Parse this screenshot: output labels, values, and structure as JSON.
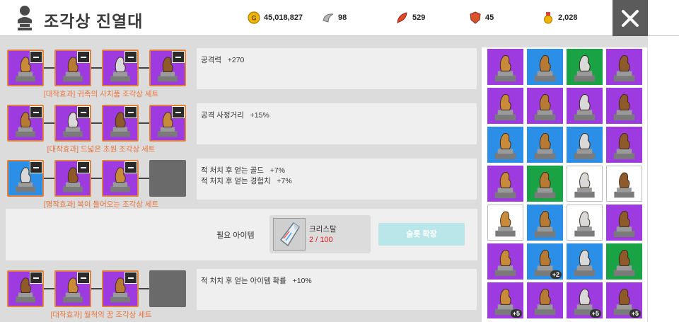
{
  "header": {
    "title": "조각상 진열대",
    "resources": [
      {
        "name": "gold",
        "icon": "gold-coin-icon",
        "value": "45,018,827"
      },
      {
        "name": "horn",
        "icon": "silver-horn-icon",
        "value": "98"
      },
      {
        "name": "feather",
        "icon": "red-feather-icon",
        "value": "529"
      },
      {
        "name": "shield",
        "icon": "shield-badge-icon",
        "value": "45"
      },
      {
        "name": "medal",
        "icon": "medal-icon",
        "value": "2,028"
      }
    ]
  },
  "sets": [
    {
      "name": "[대작효과] 귀족의 사치품 조각상 세트",
      "effects": [
        "공격력   +270"
      ],
      "slots": [
        "purple",
        "purple",
        "purple",
        "purple"
      ]
    },
    {
      "name": "[대작효과] 드넓은 초원 조각상 세트",
      "effects": [
        "공격 사정거리   +15%"
      ],
      "slots": [
        "purple",
        "purple",
        "purple",
        "purple"
      ]
    },
    {
      "name": "[명작효과] 복이 들어오는 조각상 세트",
      "effects": [
        "적 처치 후 얻는 골드   +7%",
        "적 처치 후 얻는 경험치   +7%"
      ],
      "slots": [
        "blue",
        "purple",
        "purple",
        "empty"
      ]
    },
    {
      "name": "[대작효과] 월척의 꿈 조각상 세트",
      "effects": [
        "적 처치 후 얻는 아이템 확률   +10%"
      ],
      "slots": [
        "purple",
        "purple",
        "purple",
        "empty"
      ]
    }
  ],
  "expand": {
    "required_label": "필요 아이템",
    "item_name": "크리스탈",
    "item_count": "2 / 100",
    "button_label": "슬롯 확장"
  },
  "inventory": [
    {
      "color": "purple",
      "count": ""
    },
    {
      "color": "blue",
      "count": ""
    },
    {
      "color": "green",
      "count": ""
    },
    {
      "color": "purple",
      "count": ""
    },
    {
      "color": "purple",
      "count": ""
    },
    {
      "color": "purple",
      "count": ""
    },
    {
      "color": "purple",
      "count": ""
    },
    {
      "color": "purple",
      "count": ""
    },
    {
      "color": "blue",
      "count": ""
    },
    {
      "color": "blue",
      "count": ""
    },
    {
      "color": "blue",
      "count": ""
    },
    {
      "color": "purple",
      "count": ""
    },
    {
      "color": "purple",
      "count": ""
    },
    {
      "color": "green",
      "count": ""
    },
    {
      "color": "white",
      "count": ""
    },
    {
      "color": "white",
      "count": ""
    },
    {
      "color": "white",
      "count": ""
    },
    {
      "color": "blue",
      "count": ""
    },
    {
      "color": "white",
      "count": ""
    },
    {
      "color": "purple",
      "count": ""
    },
    {
      "color": "purple",
      "count": ""
    },
    {
      "color": "blue",
      "count": "+2"
    },
    {
      "color": "blue",
      "count": ""
    },
    {
      "color": "green",
      "count": ""
    },
    {
      "color": "purple",
      "count": "+5"
    },
    {
      "color": "purple",
      "count": ""
    },
    {
      "color": "purple",
      "count": "+5"
    },
    {
      "color": "purple",
      "count": "+5"
    }
  ],
  "colors": {
    "accent_orange": "#e8733b",
    "slot_purple": "#9d3be0",
    "slot_blue": "#2b8fe8",
    "slot_green": "#1aa345",
    "count_red": "#e02020",
    "button_cyan": "#b9e6e8"
  }
}
